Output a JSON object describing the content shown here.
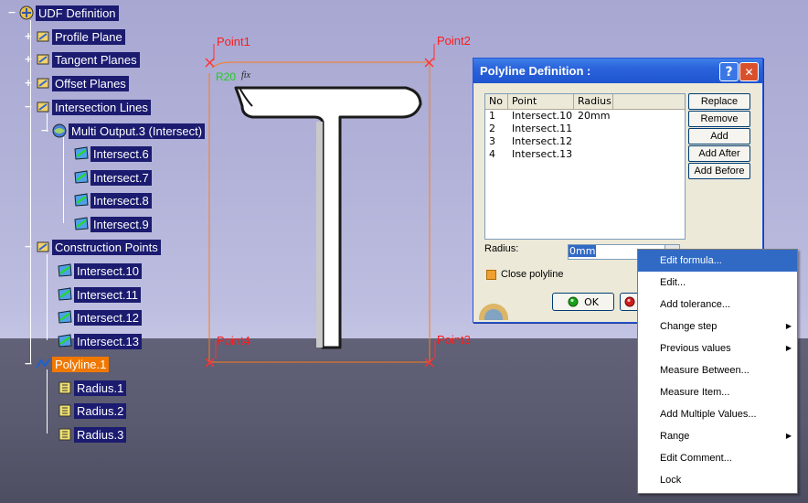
{
  "tree": {
    "root": "UDF Definition",
    "nodes": [
      {
        "label": "Profile Plane"
      },
      {
        "label": "Tangent Planes"
      },
      {
        "label": "Offset Planes"
      },
      {
        "label": "Intersection Lines"
      },
      {
        "label": "Multi Output.3 (Intersect)"
      },
      {
        "label": "Intersect.6"
      },
      {
        "label": "Intersect.7"
      },
      {
        "label": "Intersect.8"
      },
      {
        "label": "Intersect.9"
      },
      {
        "label": "Construction Points"
      },
      {
        "label": "Intersect.10"
      },
      {
        "label": "Intersect.11"
      },
      {
        "label": "Intersect.12"
      },
      {
        "label": "Intersect.13"
      },
      {
        "label": "Polyline.1"
      },
      {
        "label": "Radius.1"
      },
      {
        "label": "Radius.2"
      },
      {
        "label": "Radius.3"
      }
    ]
  },
  "sketch": {
    "point1": "Point1",
    "point2": "Point2",
    "point3": "Point3",
    "point4": "Point4",
    "radius_tag": "R20",
    "fix_tag": "fix"
  },
  "dialog": {
    "title": "Polyline Definition :",
    "help_glyph": "?",
    "close_glyph": "✕",
    "columns": [
      "No",
      "Point",
      "Radius"
    ],
    "rows": [
      {
        "no": "1",
        "point": "Intersect.10",
        "radius": "20mm"
      },
      {
        "no": "2",
        "point": "Intersect.11",
        "radius": ""
      },
      {
        "no": "3",
        "point": "Intersect.12",
        "radius": ""
      },
      {
        "no": "4",
        "point": "Intersect.13",
        "radius": ""
      }
    ],
    "buttons": {
      "replace": "Replace",
      "remove": "Remove",
      "add": "Add",
      "add_after": "Add After",
      "add_before": "Add Before"
    },
    "radius_label": "Radius:",
    "radius_value": "0mm",
    "close_polyline": "Close polyline",
    "ok": "OK"
  },
  "context_menu": {
    "items": [
      {
        "label": "Edit formula..."
      },
      {
        "label": "Edit..."
      },
      {
        "label": "Add tolerance..."
      },
      {
        "label": "Change step"
      },
      {
        "label": "Previous values"
      },
      {
        "label": "Measure Between..."
      },
      {
        "label": "Measure Item..."
      },
      {
        "label": "Add Multiple Values..."
      },
      {
        "label": "Range"
      },
      {
        "label": "Edit Comment..."
      },
      {
        "label": "Lock"
      }
    ]
  },
  "colors": {
    "tree_label_bg": "#1b1b70",
    "selected_bg": "#f07800",
    "sketch_red": "#ff1c1c",
    "menu_highlight": "#316ac5"
  }
}
